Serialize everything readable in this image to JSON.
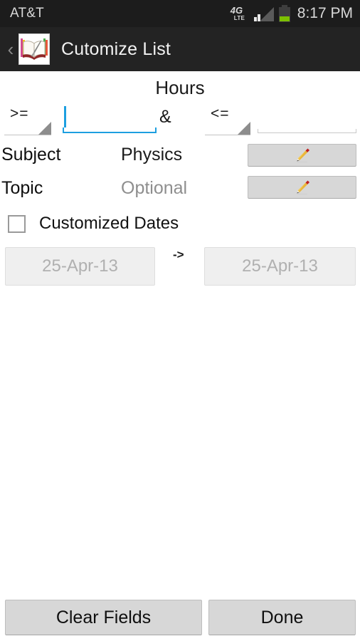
{
  "status_bar": {
    "carrier": "AT&T",
    "network_type_main": "4G",
    "network_type_sub": "LTE",
    "clock": "8:17 PM",
    "battery_percent": "35",
    "battery_fill_color": "#7cc000",
    "background_color": "#1c1c1c"
  },
  "action_bar": {
    "back_label": "‹",
    "title": "Cutomize List",
    "app_icon_name": "book-and-quill-icon",
    "background_color": "#232323"
  },
  "form": {
    "hours_title": "Hours",
    "min_operator": ">=",
    "min_value": "",
    "min_focused": true,
    "conjunction": "&",
    "max_operator": "<=",
    "max_value": "",
    "operator_options": [
      ">=",
      ">",
      "=",
      "<",
      "<="
    ],
    "subject": {
      "label": "Subject",
      "value": "Physics",
      "is_placeholder": false,
      "edit_icon": "pencil-icon"
    },
    "topic": {
      "label": "Topic",
      "value": "Optional",
      "is_placeholder": true,
      "edit_icon": "pencil-icon"
    },
    "customized_dates": {
      "label": "Customized Dates",
      "checked": false
    },
    "date_from": "25-Apr-13",
    "date_separator": "->",
    "date_to": "25-Apr-13",
    "dates_enabled": false
  },
  "footer": {
    "clear_label": "Clear Fields",
    "done_label": "Done"
  },
  "theme": {
    "accent_focus": "#1d9fe0",
    "button_face": "#d7d7d7",
    "disabled_text": "#b0b0b0"
  }
}
